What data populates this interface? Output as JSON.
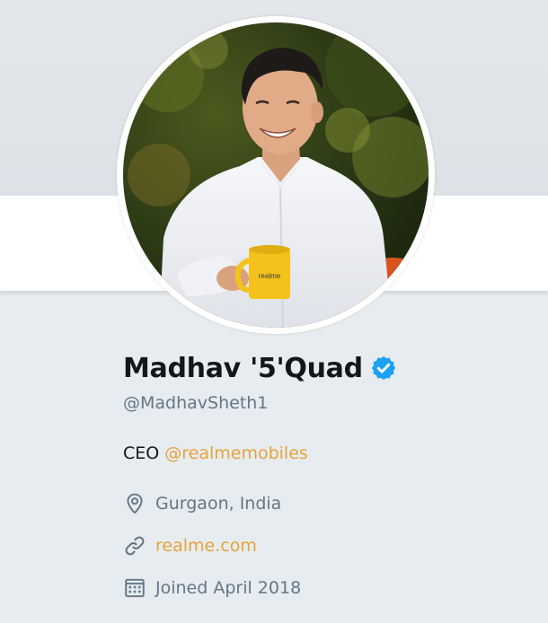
{
  "profile": {
    "display_name": "Madhav '5'Quad",
    "handle": "@MadhavSheth1",
    "bio_prefix": "CEO",
    "bio_mention": "@realmemobiles",
    "location": "Gurgaon, India",
    "website": "realme.com",
    "joined": "Joined April 2018",
    "mug_brand": "realme"
  },
  "icons": {
    "verified": "verified-badge-icon",
    "location": "location-pin-icon",
    "website": "link-icon",
    "joined": "calendar-icon"
  },
  "colors": {
    "accent": "#e8a33a",
    "verified": "#1da1f2",
    "text_primary": "#14171a",
    "text_secondary": "#657786",
    "background": "#e6ecf0"
  }
}
